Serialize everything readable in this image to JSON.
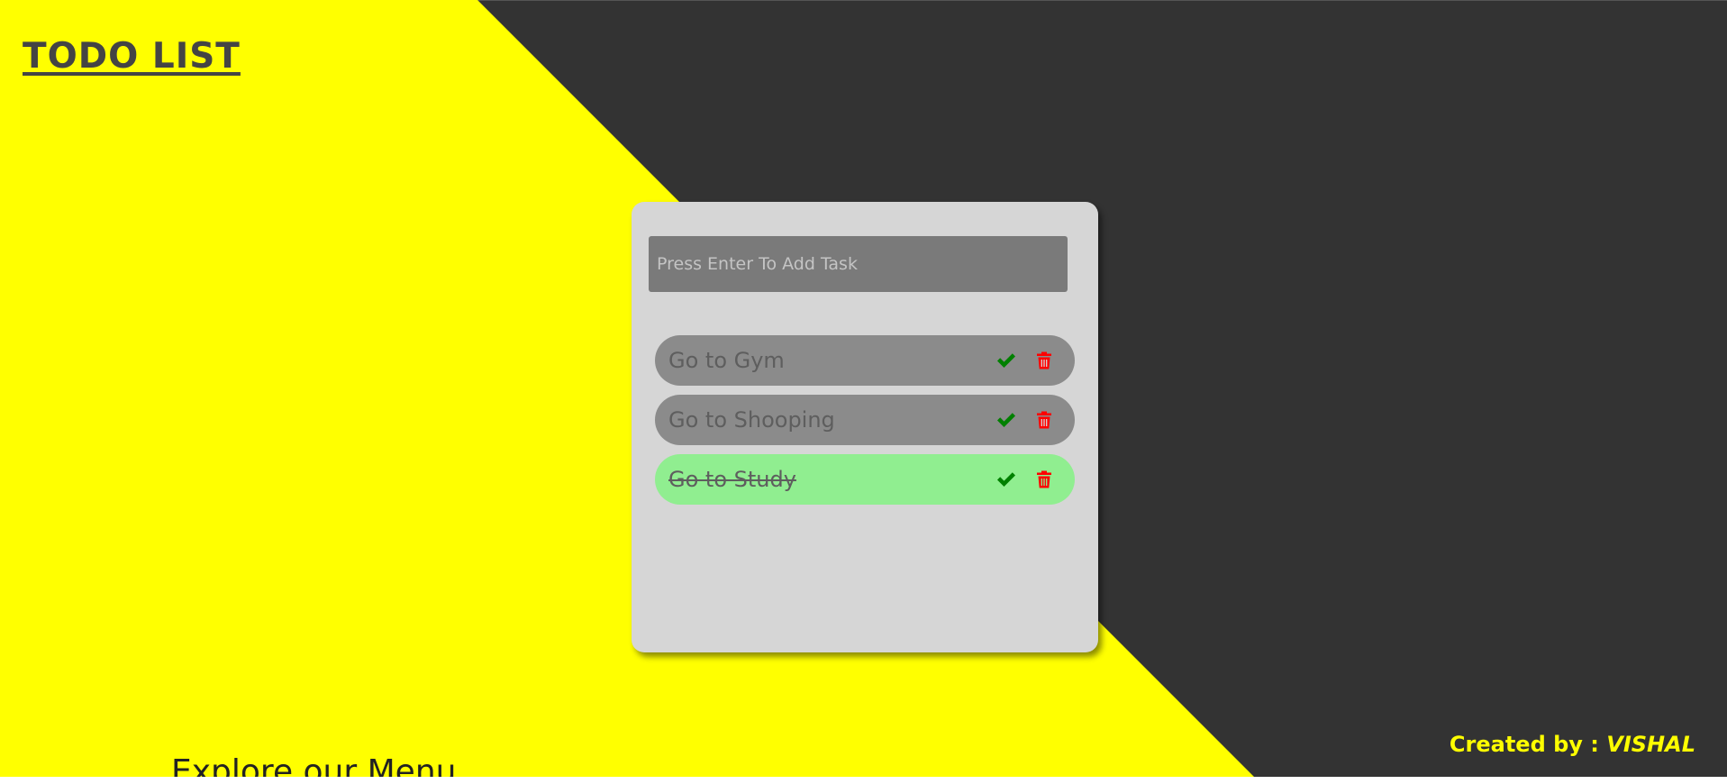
{
  "header": {
    "title": "TODO LIST"
  },
  "input": {
    "placeholder": "Press Enter To Add Task",
    "value": ""
  },
  "tasks": [
    {
      "text": "Go to Gym",
      "completed": false
    },
    {
      "text": "Go to Shooping",
      "completed": false
    },
    {
      "text": "Go to Study",
      "completed": true
    }
  ],
  "footer": {
    "credit_prefix": "Created by : ",
    "author": "VISHAL"
  },
  "below_fold": {
    "heading": "Explore our Menu"
  },
  "icons": {
    "complete": "check-icon",
    "delete": "trash-icon"
  },
  "colors": {
    "yellow_panel": "#ffff00",
    "dark_panel": "#333333",
    "card": "#d6d6d6",
    "input_bg": "#7a7a7a",
    "task_bg": "#8b8b8b",
    "task_done_bg": "#90ee90",
    "check": "#008000",
    "trash": "#ff0000",
    "credit": "#ffff00"
  }
}
